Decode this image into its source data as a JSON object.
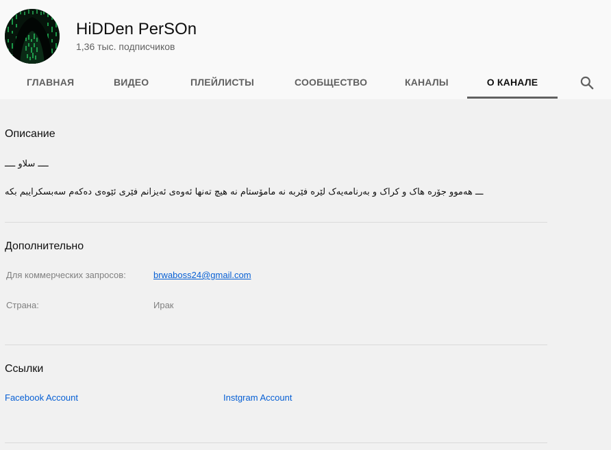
{
  "channel": {
    "name": "HiDDen PerSOn",
    "subscribers": "1,36 тыс. подписчиков"
  },
  "tabs": [
    {
      "label": "ГЛАВНАЯ",
      "active": false
    },
    {
      "label": "ВИДЕО",
      "active": false
    },
    {
      "label": "ПЛЕЙЛИСТЫ",
      "active": false
    },
    {
      "label": "СООБЩЕСТВО",
      "active": false
    },
    {
      "label": "КАНАЛЫ",
      "active": false
    },
    {
      "label": "О КАНАЛЕ",
      "active": true
    }
  ],
  "icons": {
    "search": "search-icon"
  },
  "description": {
    "title": "Описание",
    "lines": [
      "ــــ سلاو ــــ",
      "ـــ هەموو جۆرە هاک و کراک و بەرنامەیەک لێرە فێربە نە مامۆستام نە هیچ تەنها ئەوەی ئەیزانم فێری ئێوەی دەکەم سەبسکرایبم بکە"
    ]
  },
  "details": {
    "title": "Дополнительно",
    "business_label": "Для коммерческих запросов:",
    "business_email": "brwaboss24@gmail.com",
    "country_label": "Страна:",
    "country_value": "Ирак"
  },
  "links": {
    "title": "Ссылки",
    "items": [
      {
        "label": "Facebook Account"
      },
      {
        "label": "Instgram Account"
      }
    ]
  },
  "colors": {
    "header_bg": "#f9f9f9",
    "page_bg": "#f1f1f1",
    "link": "#065fd4",
    "muted_text": "#606060",
    "active_tab_indicator": "#606060"
  }
}
